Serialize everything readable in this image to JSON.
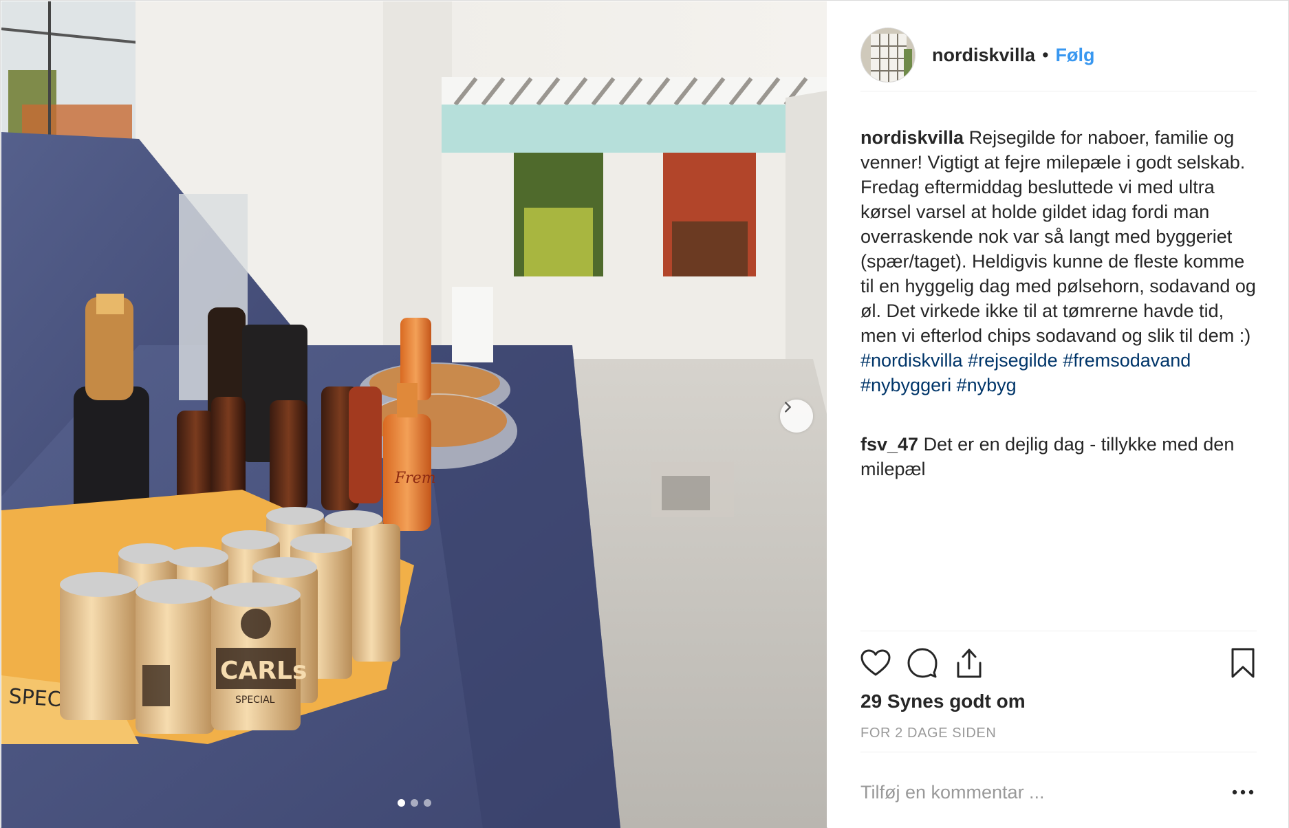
{
  "post": {
    "username": "nordiskvilla",
    "separator": "•",
    "follow_label": "Følg",
    "caption": {
      "username": "nordiskvilla",
      "text": "Rejsegilde for naboer, familie og venner! Vigtigt at fejre milepæle i godt selskab. Fredag eftermiddag besluttede vi med ultra kørsel varsel at holde gildet idag fordi man overraskende nok var så langt med byggeriet (spær/taget). Heldigvis kunne de fleste komme til en hyggelig dag med pølsehorn, sodavand og øl. Det virkede ikke til at tømrerne havde tid, men vi efterlod chips sodavand og slik til dem :)",
      "hashtags": [
        "#nordiskvilla",
        "#rejsegilde",
        "#fremsodavand",
        "#nybyggeri",
        "#nybyg"
      ]
    },
    "comments": [
      {
        "username": "fsv_47",
        "text": "Det er en dejlig dag - tillykke med den milepæl"
      }
    ],
    "likes_text": "29 Synes godt om",
    "time_text": "FOR 2 DAGE SIDEN",
    "comment_placeholder": "Tilføj en kommentar ...",
    "carousel": {
      "total": 3,
      "active": 1
    }
  },
  "photo_text": {
    "can_label": "CARLs",
    "can_sub": "SPECIAL",
    "bag_label": "SPECIAL",
    "bottle_label": "Frem"
  },
  "icons": {
    "like": "heart-icon",
    "comment": "comment-icon",
    "share": "share-icon",
    "save": "bookmark-icon",
    "next": "chevron-right-icon",
    "more": "more-horizontal-icon"
  },
  "colors": {
    "follow": "#3897f0",
    "hashtag": "#003569",
    "muted": "#999999",
    "text": "#262626"
  }
}
